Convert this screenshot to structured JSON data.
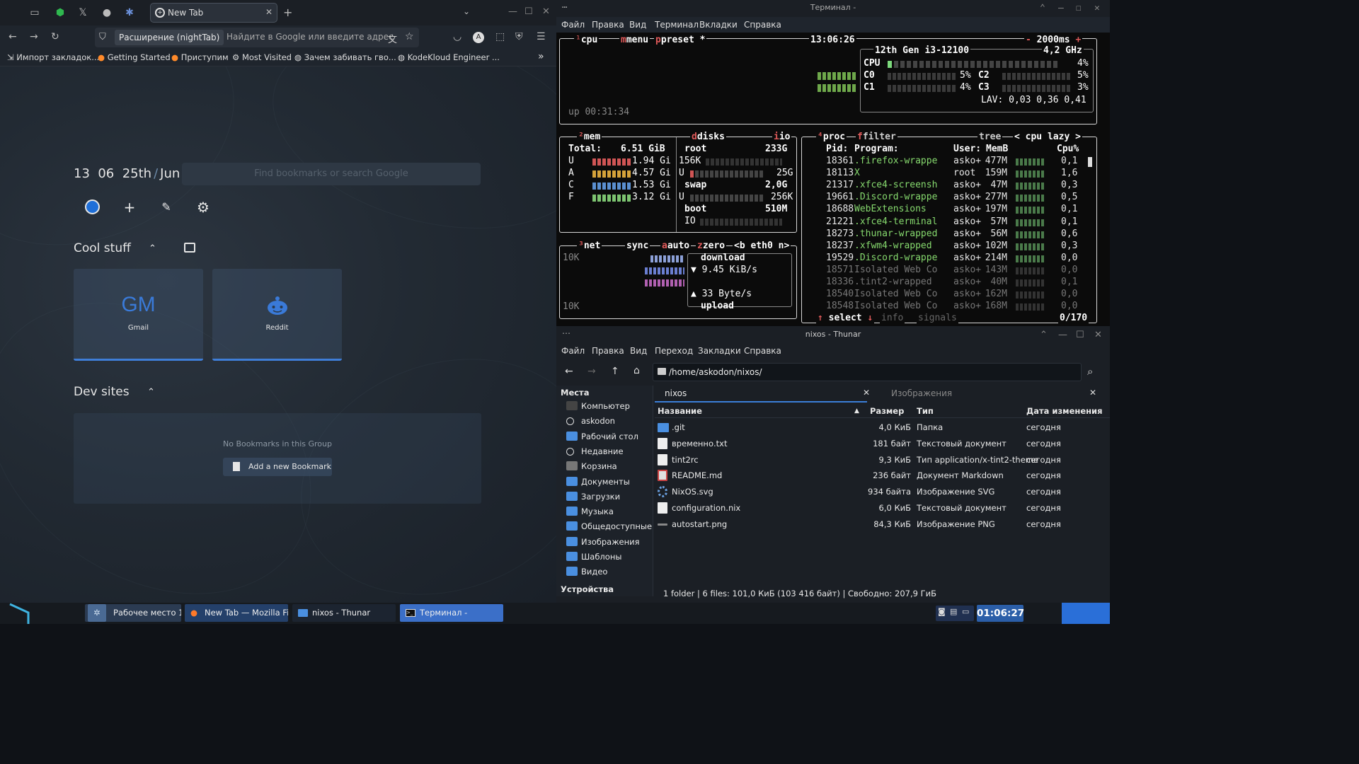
{
  "firefox": {
    "tab_title": "New Tab",
    "url_extension_chip": "Расширение (nightTab)",
    "url_placeholder": "Найдите в Google или введите адрес",
    "bookmarks": [
      "Импорт закладок...",
      "Getting Started",
      "Приступим",
      "Most Visited",
      "Зачем забивать гво...",
      "KodeKloud Engineer ..."
    ],
    "newtab": {
      "date_day": "13",
      "date_month_num": "06",
      "date_ordinal": "25th",
      "date_month": "Jun",
      "search_placeholder": "Find bookmarks or search Google",
      "group1_title": "Cool stuff",
      "tiles": [
        {
          "logo": "GM",
          "name": "Gmail"
        },
        {
          "logo": "reddit",
          "name": "Reddit"
        }
      ],
      "group2_title": "Dev sites",
      "empty_text": "No Bookmarks in this Group",
      "add_bookmark": "Add a new Bookmark"
    }
  },
  "terminal": {
    "title": "Терминал -",
    "menu": [
      "Файл",
      "Правка",
      "Вид",
      "Терминал",
      "Вкладки",
      "Справка"
    ],
    "cpu_box": {
      "t_cpu": "cpu",
      "t_menu": "menu",
      "t_preset": "preset *",
      "time": "13:06:26",
      "interval": "2000ms",
      "uptime": "up 00:31:34",
      "model": "12th Gen i3-12100",
      "freq": "4,2 GHz",
      "cpu_label": "CPU",
      "cpu_pct": "4%",
      "c0": "C0",
      "c0_pct": "5%",
      "c1": "C1",
      "c1_pct": "4%",
      "c2": "C2",
      "c2_pct": "5%",
      "c3": "C3",
      "c3_pct": "3%",
      "lav": "LAV: 0,03 0,36 0,41"
    },
    "mem_box": {
      "title": "mem",
      "disks_title": "disks",
      "io_title": "io",
      "total_label": "Total:",
      "total": "6.51 GiB",
      "u": "U",
      "u_val": "1.94 Gi",
      "a": "A",
      "a_val": "4.57 Gi",
      "c": "C",
      "c_val": "1.53 Gi",
      "f": "F",
      "f_val": "3.12 Gi",
      "root": "root",
      "root_size": "233G",
      "root_io": "156K",
      "root_u": "U",
      "root_u_val": "25G",
      "swap": "swap",
      "swap_size": "2,0G",
      "swap_u": "U",
      "swap_u_val": "256K",
      "boot": "boot",
      "boot_size": "510M",
      "boot_io": "IO"
    },
    "net_box": {
      "title": "net",
      "sync": "sync",
      "auto": "auto",
      "zero": "zero",
      "iface": "<b eth0 n>",
      "scale_top": "10K",
      "scale_bottom": "10K",
      "download": "download",
      "dl_rate": "9.45 KiB/s",
      "ul_rate": "33 Byte/s",
      "upload": "upload"
    },
    "proc_box": {
      "title": "proc",
      "filter": "filter",
      "tree": "tree",
      "sort": "< cpu lazy >",
      "headers": [
        "Pid:",
        "Program:",
        "User:",
        "MemB",
        "Cpu%"
      ],
      "rows": [
        [
          "18361",
          ".firefox-wrappe",
          "asko+",
          "477M",
          "0,1"
        ],
        [
          "18113",
          "X",
          "root",
          "159M",
          "1,6"
        ],
        [
          "21317",
          ".xfce4-screensh",
          "asko+",
          "47M",
          "0,3"
        ],
        [
          "19661",
          ".Discord-wrappe",
          "asko+",
          "277M",
          "0,5"
        ],
        [
          "18688",
          "WebExtensions",
          "asko+",
          "197M",
          "0,1"
        ],
        [
          "21221",
          ".xfce4-terminal",
          "asko+",
          "57M",
          "0,1"
        ],
        [
          "18273",
          ".thunar-wrapped",
          "asko+",
          "56M",
          "0,6"
        ],
        [
          "18237",
          ".xfwm4-wrapped",
          "asko+",
          "102M",
          "0,3"
        ],
        [
          "19529",
          ".Discord-wrappe",
          "asko+",
          "214M",
          "0,0"
        ],
        [
          "18571",
          "Isolated Web Co",
          "asko+",
          "143M",
          "0,0"
        ],
        [
          "18336",
          ".tint2-wrapped",
          "asko+",
          "40M",
          "0,1"
        ],
        [
          "18540",
          "Isolated Web Co",
          "asko+",
          "162M",
          "0,0"
        ],
        [
          "18548",
          "Isolated Web Co",
          "asko+",
          "168M",
          "0,0"
        ]
      ],
      "select": "select",
      "info": "info",
      "signals": "signals",
      "count": "0/170"
    }
  },
  "thunar": {
    "title": "nixos - Thunar",
    "menu": [
      "Файл",
      "Правка",
      "Вид",
      "Переход",
      "Закладки",
      "Справка"
    ],
    "path": "/home/askodon/nixos/",
    "places_header": "Места",
    "places": [
      {
        "name": "Компьютер",
        "color": "#444"
      },
      {
        "name": "askodon",
        "color": "none"
      },
      {
        "name": "Рабочий стол",
        "color": "#4a8fe0"
      },
      {
        "name": "Недавние",
        "color": "none"
      },
      {
        "name": "Корзина",
        "color": "#777"
      },
      {
        "name": "Документы",
        "color": "#4a8fe0"
      },
      {
        "name": "Загрузки",
        "color": "#4a8fe0"
      },
      {
        "name": "Музыка",
        "color": "#4a8fe0"
      },
      {
        "name": "Общедоступные",
        "color": "#4a8fe0"
      },
      {
        "name": "Изображения",
        "color": "#4a8fe0"
      },
      {
        "name": "Шаблоны",
        "color": "#4a8fe0"
      },
      {
        "name": "Видео",
        "color": "#4a8fe0"
      }
    ],
    "devices_header": "Устройства",
    "tabs": [
      "nixos",
      "Изображения"
    ],
    "columns": [
      "Название",
      "Размер",
      "Тип",
      "Дата изменения"
    ],
    "files": [
      {
        "name": ".git",
        "size": "4,0 КиБ",
        "type": "Папка",
        "date": "сегодня",
        "icon": "folder"
      },
      {
        "name": "временно.txt",
        "size": "181 байт",
        "type": "Текстовый документ",
        "date": "сегодня",
        "icon": "text"
      },
      {
        "name": "tint2rc",
        "size": "9,3 КиБ",
        "type": "Тип application/x-tint2-theme",
        "date": "сегодня",
        "icon": "text"
      },
      {
        "name": "README.md",
        "size": "236 байт",
        "type": "Документ Markdown",
        "date": "сегодня",
        "icon": "md"
      },
      {
        "name": "NixOS.svg",
        "size": "934 байта",
        "type": "Изображение SVG",
        "date": "сегодня",
        "icon": "nix"
      },
      {
        "name": "configuration.nix",
        "size": "6,0 КиБ",
        "type": "Текстовый документ",
        "date": "сегодня",
        "icon": "text"
      },
      {
        "name": "autostart.png",
        "size": "84,3 КиБ",
        "type": "Изображение PNG",
        "date": "сегодня",
        "icon": "png"
      }
    ],
    "status": "1 folder  |  6 files: 101,0 КиБ (103 416 байт)  |  Свободно: 207,9 ГиБ"
  },
  "taskbar": {
    "workspace": "Рабочее место 1",
    "tasks": [
      "New Tab — Mozilla Fir...",
      "nixos - Thunar",
      "Терминал -"
    ],
    "clock": "01:06:27"
  }
}
